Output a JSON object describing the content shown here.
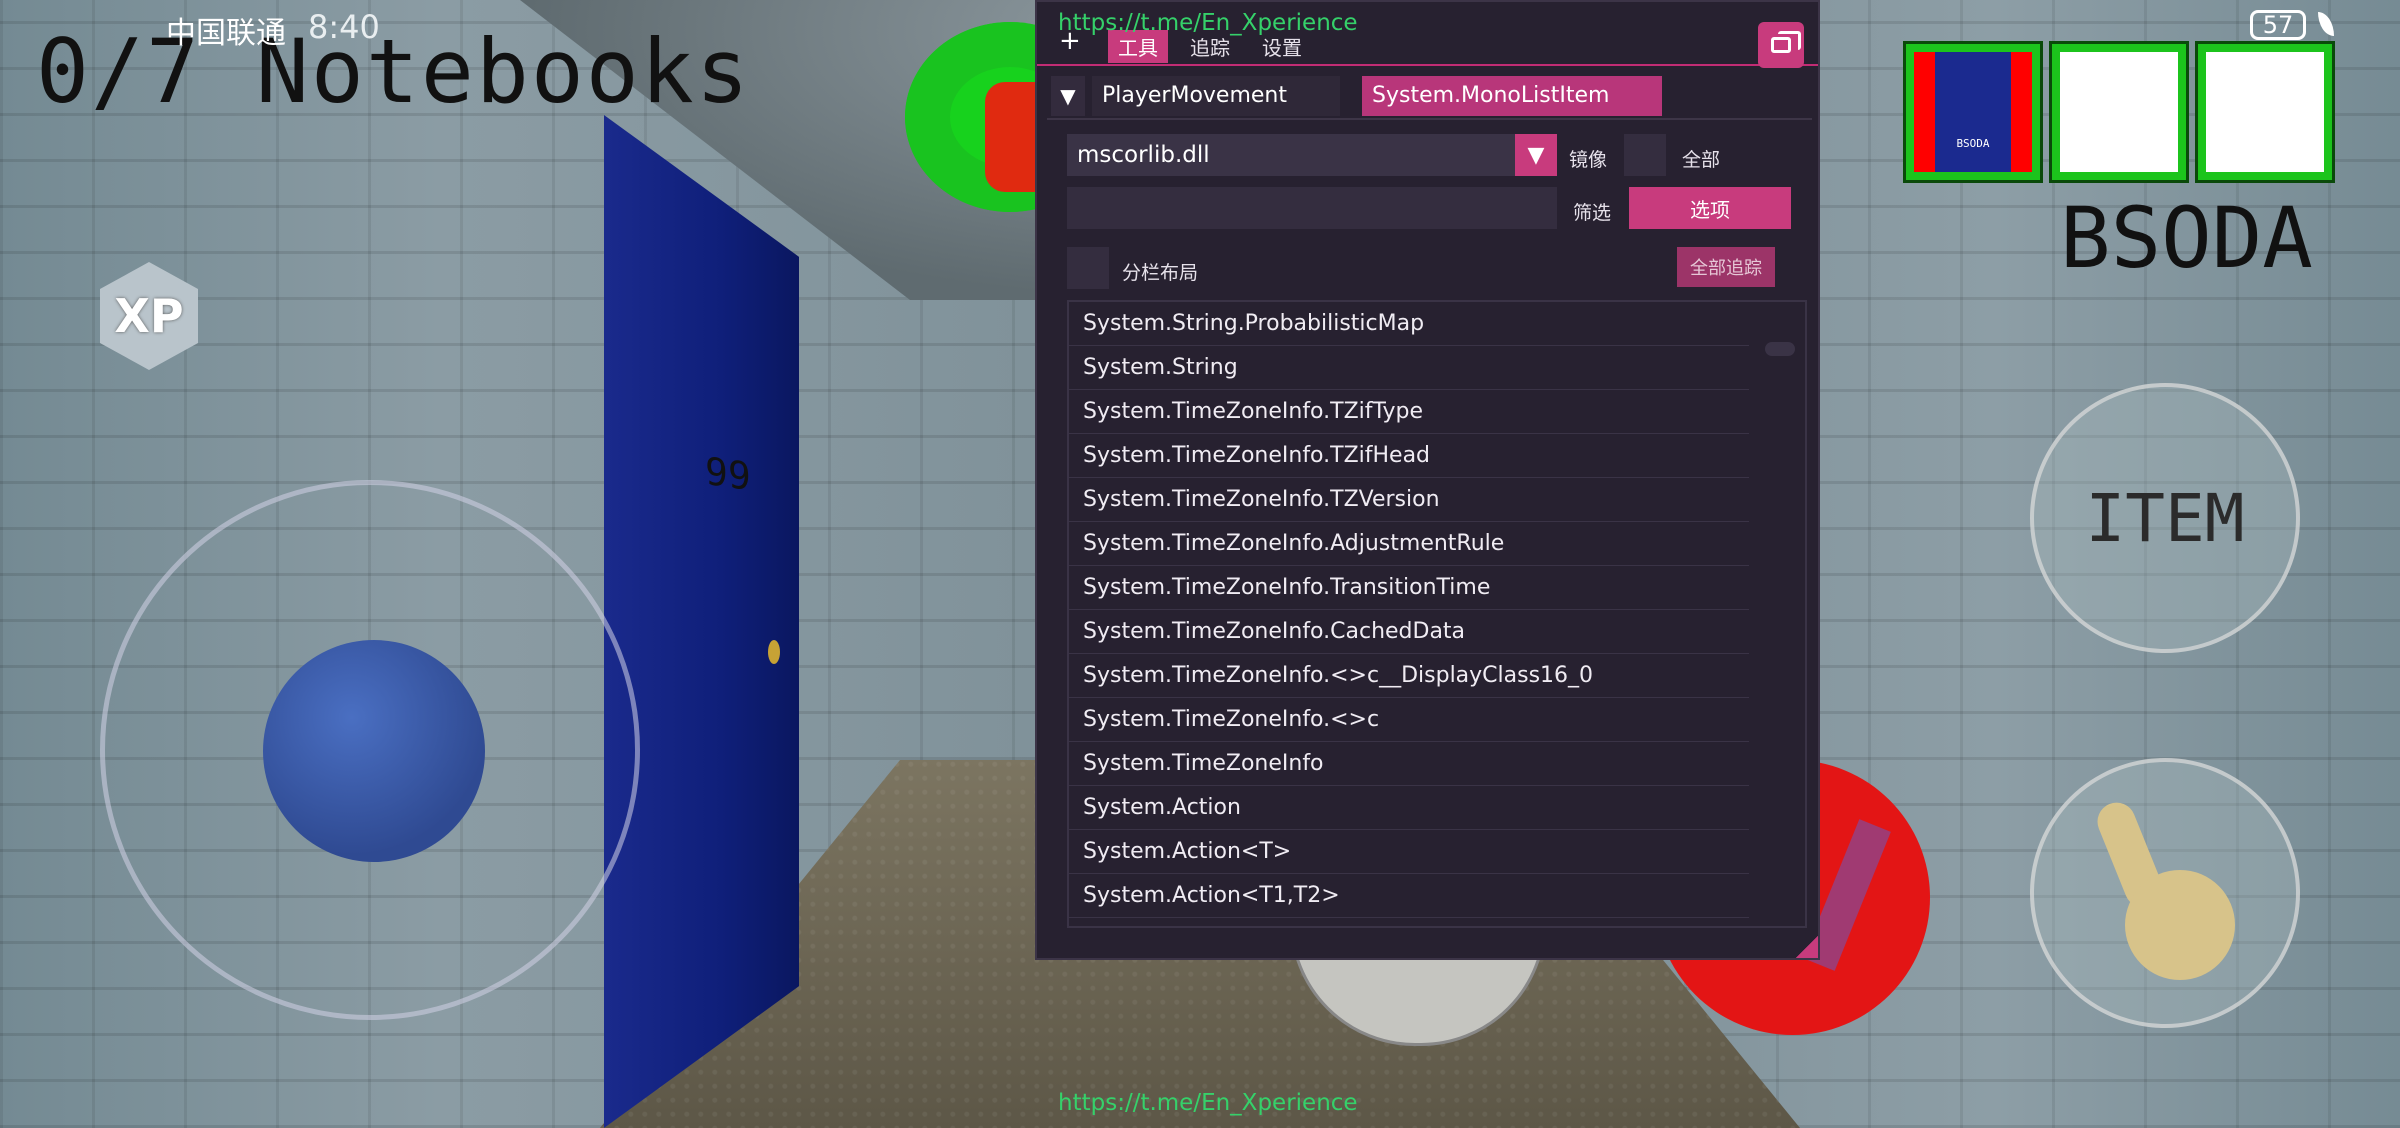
{
  "status_bar": {
    "carrier": "中国联通",
    "time": "8:40",
    "battery": "57"
  },
  "watermark": {
    "top": "https://t.me/En_Xperience",
    "bottom": "https://t.me/En_Xperience"
  },
  "hud": {
    "notebooks": "0/7 Notebooks",
    "xp_label": "XP",
    "item_button": "ITEM",
    "selected_item": "BSODA",
    "can_label": "BSODA",
    "door_number": "99"
  },
  "panel": {
    "top_tabs": [
      "+",
      "工具",
      "追踪",
      "设置"
    ],
    "class_tabs": [
      "PlayerMovement",
      "System.MonoListItem"
    ],
    "assembly_select": "mscorlib.dll",
    "mirror_label": "镜像",
    "all_label": "全部",
    "filter_label": "筛选",
    "filter_value": "",
    "options_button": "选项",
    "split_layout_label": "分栏布局",
    "trace_all_button": "全部追踪",
    "items": [
      "System.String.ProbabilisticMap",
      "System.String",
      "System.TimeZoneInfo.TZifType",
      "System.TimeZoneInfo.TZifHead",
      "System.TimeZoneInfo.TZVersion",
      "System.TimeZoneInfo.AdjustmentRule",
      "System.TimeZoneInfo.TransitionTime",
      "System.TimeZoneInfo.CachedData",
      "System.TimeZoneInfo.<>c__DisplayClass16_0",
      "System.TimeZoneInfo.<>c",
      "System.TimeZoneInfo",
      "System.Action",
      "System.Action<T>",
      "System.Action<T1,T2>"
    ]
  },
  "colors": {
    "accent": "#c83b7d",
    "panel_bg": "#272130",
    "watermark": "#35d16a"
  },
  "icons": {
    "window": "window-stack-icon",
    "collapse": "collapse-triangle-icon",
    "dropdown": "dropdown-arrow-icon",
    "hand": "hand-pointer-icon"
  }
}
